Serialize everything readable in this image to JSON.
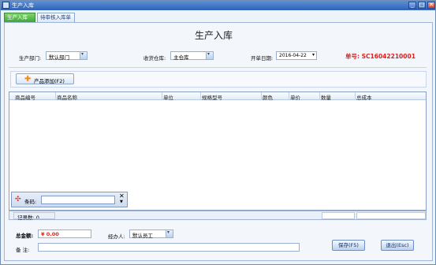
{
  "window": {
    "title": "生产入库"
  },
  "tabs": [
    {
      "label": "生产入库单"
    },
    {
      "label": "待审核入库单"
    }
  ],
  "page_title": "生产入库",
  "header": {
    "dept_label": "生产部门:",
    "dept_value": "默认部门",
    "warehouse_label": "收货仓库:",
    "warehouse_value": "主仓库",
    "date_label": "开单日期:",
    "date_value": "2016-04-22",
    "order_no": "单号:  SC16042210001"
  },
  "toolbar": {
    "add_product_label": "产品添加(F2)"
  },
  "grid": {
    "columns": [
      "商品编号",
      "商品名称",
      "单位",
      "规格型号",
      "颜色",
      "单价",
      "数量",
      "总成本"
    ]
  },
  "barcode": {
    "label": "条码:",
    "value": ""
  },
  "status": {
    "record_count": "记录数: 0"
  },
  "footer": {
    "total_label": "总金额:",
    "total_value": "¥ 0.00",
    "handler_label": "经办人:",
    "handler_value": "默认员工",
    "remark_label": "备    注:",
    "remark_value": "",
    "save_label": "保存(F5)",
    "exit_label": "退出(Esc)"
  },
  "colors": {
    "accent": "#e0201a",
    "tab_active": "#3ea63a",
    "titlebar": "#2f63b8"
  }
}
